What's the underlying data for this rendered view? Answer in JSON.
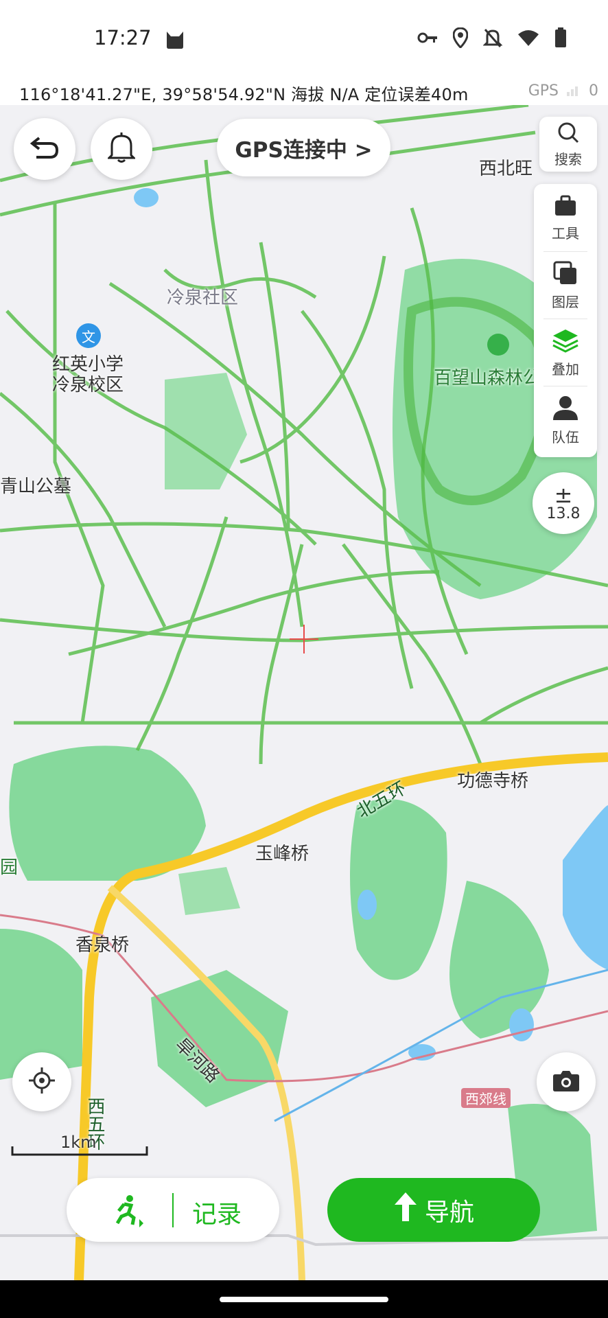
{
  "status_bar": {
    "time": "17:27",
    "icons": [
      "cat-icon",
      "key-icon",
      "location-icon",
      "bell-off-icon",
      "wifi-icon",
      "battery-icon"
    ]
  },
  "coord_bar": {
    "coordinates": "116°18'41.27\"E, 39°58'54.92\"N  海拔 N/A  定位误差40m",
    "gps_label": "GPS",
    "gps_count": "0"
  },
  "map": {
    "labels": {
      "xibeiwang": "西北旺",
      "lengquan": "冷泉社区",
      "school": "红英小学\n冷泉校区",
      "baiwangshan": "百望山森林公",
      "qingshan": "青山公墓",
      "gongdesi": "功德寺桥",
      "beiwuhuan": "北五环",
      "yufeng": "玉峰桥",
      "xiangquan": "香泉桥",
      "hanhe": "旱河路",
      "xijiao": "西郊线",
      "xiwuhuan": "西五环",
      "yuan": "园"
    },
    "colors": {
      "track": "#5cbf4f",
      "park": "#86d99c",
      "water": "#7ec8f5",
      "road": "#f7c928"
    }
  },
  "controls": {
    "gps_button": "GPS连接中 >",
    "search_label": "搜索",
    "tools": [
      {
        "label": "工具",
        "icon": "toolbox-icon"
      },
      {
        "label": "图层",
        "icon": "layers-icon"
      },
      {
        "label": "叠加",
        "icon": "overlay-icon"
      },
      {
        "label": "队伍",
        "icon": "team-icon"
      }
    ],
    "zoom_level": "13.8",
    "zoom_symbol": "±",
    "scale_label": "1km",
    "record_label": "记录",
    "navigate_label": "导航"
  }
}
